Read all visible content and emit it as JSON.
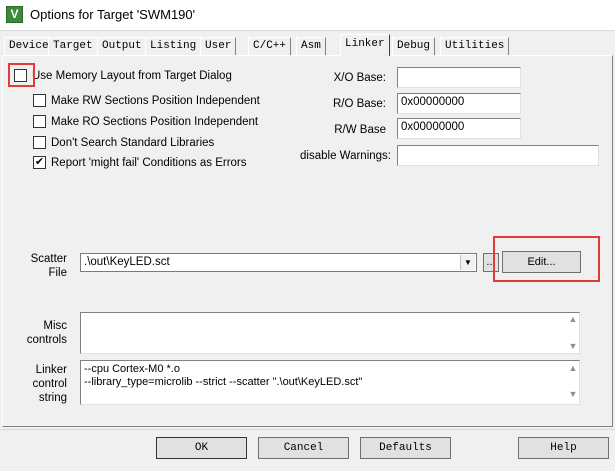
{
  "window": {
    "title": "Options for Target 'SWM190'",
    "icon_letter": "V"
  },
  "tabs": [
    {
      "label": "Device",
      "active": false
    },
    {
      "label": "Target",
      "active": false
    },
    {
      "label": "Output",
      "active": false
    },
    {
      "label": "Listing",
      "active": false
    },
    {
      "label": "User",
      "active": false
    },
    {
      "label": "C/C++",
      "active": false
    },
    {
      "label": "Asm",
      "active": false
    },
    {
      "label": "Linker",
      "active": true
    },
    {
      "label": "Debug",
      "active": false
    },
    {
      "label": "Utilities",
      "active": false
    }
  ],
  "options": {
    "use_memory_layout": {
      "label": "Use Memory Layout from Target Dialog",
      "checked": false
    },
    "rw_position_independent": {
      "label": "Make RW Sections Position Independent",
      "checked": false
    },
    "ro_position_independent": {
      "label": "Make RO Sections Position Independent",
      "checked": false
    },
    "dont_search_std_libs": {
      "label": "Don't Search Standard Libraries",
      "checked": false
    },
    "report_might_fail": {
      "label": "Report 'might fail' Conditions as Errors",
      "checked": true
    }
  },
  "bases": {
    "xo_label": "X/O Base:",
    "xo_value": "",
    "ro_label": "R/O Base:",
    "ro_value": "0x00000000",
    "rw_label": "R/W Base",
    "rw_value": "0x00000000",
    "disable_warnings_label": "disable Warnings:",
    "disable_warnings_value": ""
  },
  "scatter": {
    "label_line1": "Scatter",
    "label_line2": "File",
    "value": ".\\out\\KeyLED.sct",
    "browse_label": "...",
    "edit_label": "Edit..."
  },
  "misc": {
    "label_line1": "Misc",
    "label_line2": "controls",
    "value": ""
  },
  "linker_control": {
    "label_line1": "Linker",
    "label_line2": "control",
    "label_line3": "string",
    "line1": "--cpu Cortex-M0 *.o",
    "line2": "--library_type=microlib --strict --scatter \".\\out\\KeyLED.sct\""
  },
  "buttons": {
    "ok": "OK",
    "cancel": "Cancel",
    "defaults": "Defaults",
    "help": "Help"
  },
  "colors": {
    "highlight_box": "#e03c3c",
    "dialog_bg": "#f0f0f0"
  }
}
